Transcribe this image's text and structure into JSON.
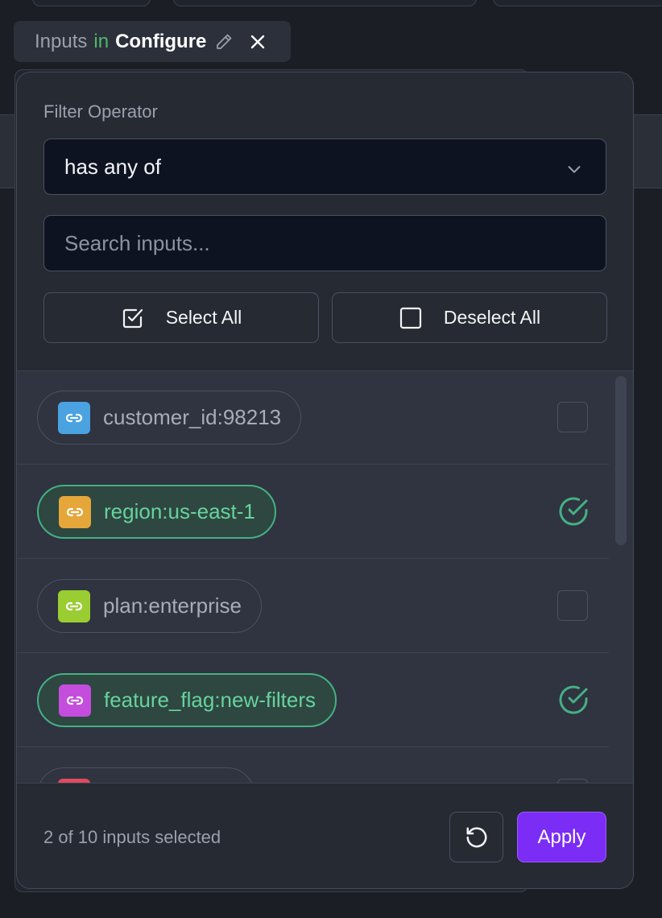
{
  "header": {
    "prefix": "Inputs",
    "connector": "in",
    "context": "Configure"
  },
  "filter": {
    "label": "Filter Operator",
    "operator": "has any of"
  },
  "search": {
    "placeholder": "Search inputs..."
  },
  "bulk": {
    "select_all": "Select All",
    "deselect_all": "Deselect All"
  },
  "items": [
    {
      "label": "customer_id:98213",
      "color": "#4aa3e0",
      "selected": false,
      "icon": "link-icon"
    },
    {
      "label": "region:us-east-1",
      "color": "#e5a63a",
      "selected": true,
      "icon": "link-icon"
    },
    {
      "label": "plan:enterprise",
      "color": "#9acd32",
      "selected": false,
      "icon": "link-icon"
    },
    {
      "label": "feature_flag:new-filters",
      "color": "#c44dde",
      "selected": true,
      "icon": "link-icon"
    },
    {
      "label": "",
      "color": "#e04a5f",
      "selected": false,
      "icon": "link-icon"
    }
  ],
  "footer": {
    "count_text": "2 of 10 inputs selected",
    "apply": "Apply"
  },
  "colors": {
    "accent": "#7b2cf5",
    "selected_green": "#45b083"
  }
}
